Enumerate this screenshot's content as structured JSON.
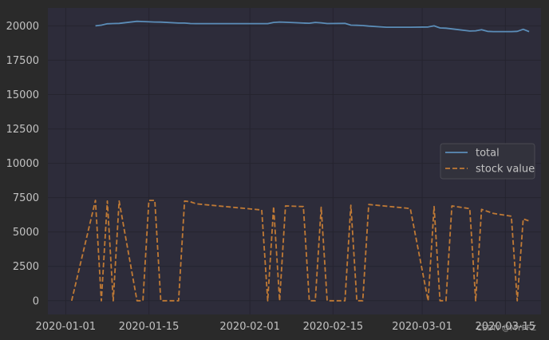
{
  "colors": {
    "figure_bg": "#2a2a2a",
    "plot_bg": "#2d2c3a",
    "grid": "#25242f",
    "tick_text": "#c2c2c2",
    "legend_bg": "#33333d",
    "legend_border": "#4a4a52"
  },
  "watermark": "CSDN @MYFFZ",
  "chart_data": {
    "type": "line",
    "title": "",
    "xlabel": "",
    "ylabel": "",
    "grid": true,
    "legend_position": "center-right",
    "x_ticks": [
      "2020-01-01",
      "2020-01-15",
      "2020-02-01",
      "2020-02-15",
      "2020-03-01",
      "2020-03-15"
    ],
    "y_ticks": [
      0,
      2500,
      5000,
      7500,
      10000,
      12500,
      15000,
      17500,
      20000
    ],
    "xlim": [
      "2019-12-29",
      "2020-03-21"
    ],
    "ylim": [
      -1000,
      21300
    ],
    "series": [
      {
        "name": "total",
        "color": "#5b8db8",
        "dash": "solid",
        "points": [
          [
            "2020-01-06",
            20000
          ],
          [
            "2020-01-07",
            20050
          ],
          [
            "2020-01-08",
            20150
          ],
          [
            "2020-01-09",
            20170
          ],
          [
            "2020-01-10",
            20180
          ],
          [
            "2020-01-13",
            20330
          ],
          [
            "2020-01-14",
            20310
          ],
          [
            "2020-01-16",
            20280
          ],
          [
            "2020-01-17",
            20270
          ],
          [
            "2020-01-20",
            20200
          ],
          [
            "2020-01-21",
            20200
          ],
          [
            "2020-01-22",
            20170
          ],
          [
            "2020-01-23",
            20160
          ],
          [
            "2020-02-03",
            20160
          ],
          [
            "2020-02-04",
            20160
          ],
          [
            "2020-02-05",
            20250
          ],
          [
            "2020-02-06",
            20280
          ],
          [
            "2020-02-07",
            20260
          ],
          [
            "2020-02-10",
            20200
          ],
          [
            "2020-02-11",
            20190
          ],
          [
            "2020-02-12",
            20250
          ],
          [
            "2020-02-13",
            20220
          ],
          [
            "2020-02-14",
            20170
          ],
          [
            "2020-02-17",
            20180
          ],
          [
            "2020-02-18",
            20050
          ],
          [
            "2020-02-19",
            20040
          ],
          [
            "2020-02-20",
            20020
          ],
          [
            "2020-02-21",
            19980
          ],
          [
            "2020-02-24",
            19900
          ],
          [
            "2020-02-25",
            19900
          ],
          [
            "2020-02-26",
            19900
          ],
          [
            "2020-02-27",
            19900
          ],
          [
            "2020-02-28",
            19900
          ],
          [
            "2020-03-02",
            19920
          ],
          [
            "2020-03-03",
            20000
          ],
          [
            "2020-03-04",
            19850
          ],
          [
            "2020-03-05",
            19830
          ],
          [
            "2020-03-06",
            19780
          ],
          [
            "2020-03-09",
            19620
          ],
          [
            "2020-03-10",
            19640
          ],
          [
            "2020-03-11",
            19720
          ],
          [
            "2020-03-12",
            19600
          ],
          [
            "2020-03-13",
            19580
          ],
          [
            "2020-03-16",
            19580
          ],
          [
            "2020-03-17",
            19600
          ],
          [
            "2020-03-18",
            19750
          ],
          [
            "2020-03-19",
            19580
          ]
        ]
      },
      {
        "name": "stock value",
        "color": "#c07a35",
        "dash": "dashed",
        "points": [
          [
            "2020-01-02",
            0
          ],
          [
            "2020-01-06",
            7300
          ],
          [
            "2020-01-07",
            0
          ],
          [
            "2020-01-08",
            7250
          ],
          [
            "2020-01-09",
            0
          ],
          [
            "2020-01-10",
            7250
          ],
          [
            "2020-01-13",
            0
          ],
          [
            "2020-01-14",
            0
          ],
          [
            "2020-01-15",
            7300
          ],
          [
            "2020-01-16",
            7300
          ],
          [
            "2020-01-17",
            0
          ],
          [
            "2020-01-20",
            0
          ],
          [
            "2020-01-21",
            7250
          ],
          [
            "2020-01-22",
            7200
          ],
          [
            "2020-01-23",
            7050
          ],
          [
            "2020-02-03",
            6600
          ],
          [
            "2020-02-04",
            0
          ],
          [
            "2020-02-05",
            6850
          ],
          [
            "2020-02-06",
            0
          ],
          [
            "2020-02-07",
            6900
          ],
          [
            "2020-02-10",
            6850
          ],
          [
            "2020-02-11",
            0
          ],
          [
            "2020-02-12",
            0
          ],
          [
            "2020-02-13",
            6800
          ],
          [
            "2020-02-14",
            0
          ],
          [
            "2020-02-17",
            0
          ],
          [
            "2020-02-18",
            6950
          ],
          [
            "2020-02-19",
            0
          ],
          [
            "2020-02-20",
            0
          ],
          [
            "2020-02-21",
            7000
          ],
          [
            "2020-02-27",
            6750
          ],
          [
            "2020-02-28",
            6700
          ],
          [
            "2020-03-02",
            0
          ],
          [
            "2020-03-03",
            6850
          ],
          [
            "2020-03-04",
            0
          ],
          [
            "2020-03-05",
            0
          ],
          [
            "2020-03-06",
            6900
          ],
          [
            "2020-03-09",
            6700
          ],
          [
            "2020-03-10",
            0
          ],
          [
            "2020-03-11",
            6650
          ],
          [
            "2020-03-12",
            6500
          ],
          [
            "2020-03-13",
            6350
          ],
          [
            "2020-03-16",
            6150
          ],
          [
            "2020-03-17",
            0
          ],
          [
            "2020-03-18",
            5950
          ],
          [
            "2020-03-19",
            5800
          ]
        ]
      }
    ]
  }
}
